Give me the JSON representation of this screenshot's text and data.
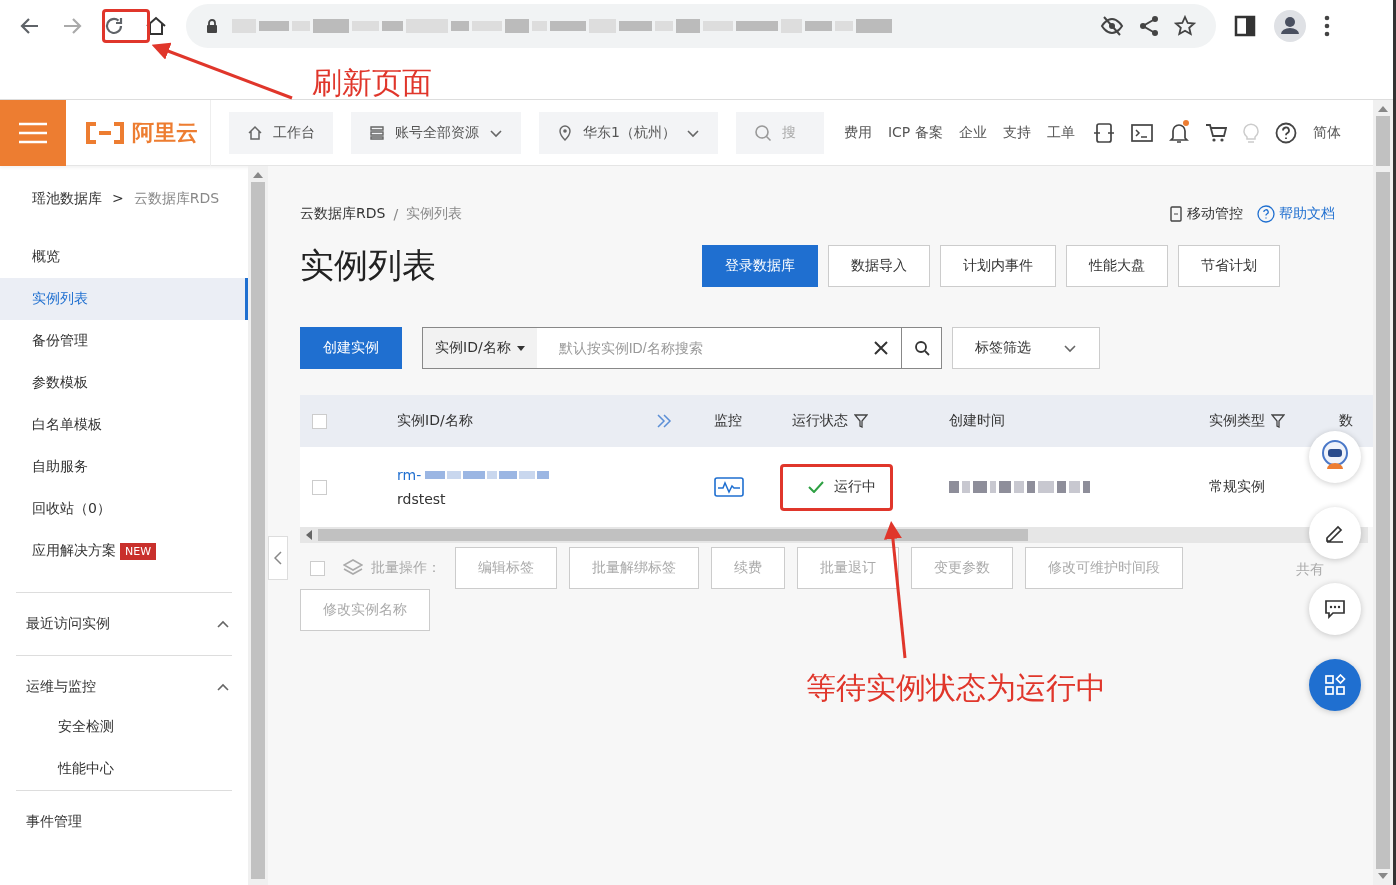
{
  "annotations": [
    {
      "kind": "reload",
      "text": "刷新页面"
    },
    {
      "kind": "status",
      "text": "等待实例状态为运行中"
    }
  ],
  "header": {
    "logo": "阿里云",
    "nav": [
      {
        "label": "工作台",
        "dropdown": false
      },
      {
        "label": "账号全部资源",
        "dropdown": true
      },
      {
        "label": "华东1（杭州）",
        "dropdown": true
      }
    ],
    "search_placeholder": "搜",
    "links": [
      "费用",
      "ICP 备案",
      "企业",
      "支持",
      "工单"
    ],
    "notification_dot": true,
    "language": "简体"
  },
  "sidebar": {
    "breadcrumb": [
      "瑶池数据库",
      "云数据库RDS"
    ],
    "breadcrumb_separator": ">",
    "items": [
      {
        "label": "概览",
        "selected": false
      },
      {
        "label": "实例列表",
        "selected": true
      },
      {
        "label": "备份管理",
        "selected": false
      },
      {
        "label": "参数模板",
        "selected": false
      },
      {
        "label": "白名单模板",
        "selected": false
      },
      {
        "label": "自助服务",
        "selected": false
      },
      {
        "label": "回收站（0）",
        "selected": false
      },
      {
        "label": "应用解决方案",
        "selected": false,
        "badge": "NEW"
      }
    ],
    "groups": [
      {
        "title": "最近访问实例",
        "expanded": true
      },
      {
        "title": "运维与监控",
        "expanded": true,
        "children": [
          {
            "label": "安全检测"
          },
          {
            "label": "性能中心"
          }
        ]
      },
      {
        "title": "事件管理"
      }
    ]
  },
  "main": {
    "breadcrumb": [
      "云数据库RDS",
      "实例列表"
    ],
    "breadcrumb_separator": "/",
    "top_links": [
      {
        "label": "移动管控"
      },
      {
        "label": "帮助文档"
      }
    ],
    "title": "实例列表",
    "actions": [
      {
        "label": "登录数据库",
        "primary": true
      },
      {
        "label": "数据导入",
        "primary": false
      },
      {
        "label": "计划内事件",
        "primary": false
      },
      {
        "label": "性能大盘",
        "primary": false
      },
      {
        "label": "节省计划",
        "primary": false
      }
    ],
    "create_button": "创建实例",
    "search": {
      "scope": "实例ID/名称",
      "placeholder": "默认按实例ID/名称搜索"
    },
    "tag_filter": "标签筛选",
    "table": {
      "select_all_checked": false,
      "columns": [
        {
          "label": "实例ID/名称",
          "filter": false,
          "expand": true
        },
        {
          "label": "监控",
          "filter": false
        },
        {
          "label": "运行状态",
          "filter": true
        },
        {
          "label": "创建时间",
          "filter": false
        },
        {
          "label": "实例类型",
          "filter": true
        },
        {
          "label": "数",
          "filter": false
        }
      ],
      "rows": [
        {
          "checked": false,
          "id": "rm-",
          "name": "rdstest",
          "status": "运行中",
          "running": true,
          "type": "常规实例"
        }
      ]
    },
    "batch": {
      "checked": false,
      "label": "批量操作：",
      "buttons": [
        {
          "label": "编辑标签",
          "disabled": true
        },
        {
          "label": "批量解绑标签",
          "disabled": true
        },
        {
          "label": "续费",
          "disabled": true
        },
        {
          "label": "批量退订",
          "disabled": true
        },
        {
          "label": "变更参数",
          "disabled": true
        },
        {
          "label": "修改可维护时间段",
          "disabled": true
        },
        {
          "label": "修改实例名称",
          "disabled": true
        }
      ],
      "total": "共有"
    }
  }
}
